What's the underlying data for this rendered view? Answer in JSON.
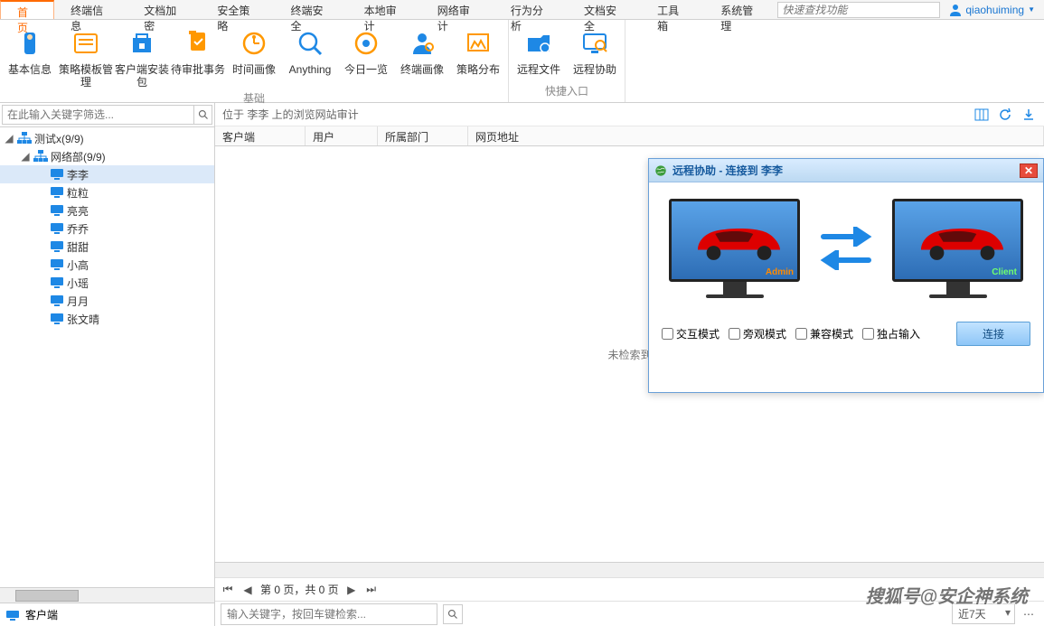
{
  "tabs": [
    "首页",
    "终端信息",
    "文档加密",
    "安全策略",
    "终端安全",
    "本地审计",
    "网络审计",
    "行为分析",
    "文档安全",
    "工具箱",
    "系统管理"
  ],
  "active_tab_index": 0,
  "top_search_placeholder": "快速查找功能",
  "user_name": "qiaohuiming",
  "ribbon_groups": [
    {
      "label": "基础",
      "items": [
        "基本信息",
        "策略模板管理",
        "客户端安装包",
        "待审批事务",
        "时间画像",
        "Anything",
        "今日一览",
        "终端画像",
        "策略分布"
      ]
    },
    {
      "label": "快捷入口",
      "items": [
        "远程文件",
        "远程协助"
      ]
    }
  ],
  "filter_placeholder": "在此输入关键字筛选...",
  "tree": {
    "root": {
      "label": "测试x(9/9)"
    },
    "dept": {
      "label": "网络部(9/9)"
    },
    "members": [
      "李李",
      "粒粒",
      "亮亮",
      "乔乔",
      "甜甜",
      "小高",
      "小瑶",
      "月月",
      "张文晴"
    ],
    "selected_index": 0
  },
  "sidebar_footer": "客户端",
  "breadcrumb": "位于 李李 上的浏览网站审计",
  "columns": {
    "c0": "客户端",
    "c1": "用户",
    "c2": "所属部门",
    "c3": "网页地址"
  },
  "empty_text": "未检索到",
  "pager": "第 0 页，共 0 页",
  "bottom_search_placeholder": "输入关键字，按回车键检索...",
  "date_filter": "近7天",
  "dialog": {
    "title": "远程协助 - 连接到 李李",
    "admin_label": "Admin",
    "client_label": "Client",
    "opts": [
      "交互模式",
      "旁观模式",
      "兼容模式",
      "独占输入"
    ],
    "connect": "连接"
  },
  "watermark": "搜狐号@安企神系统",
  "ribbon_colors": [
    "#1e88e5",
    "#ff9800",
    "#1e88e5",
    "#ff9800",
    "#ff9800",
    "#1e88e5",
    "#ff9800",
    "#1e88e5",
    "#ff9800",
    "#1e88e5",
    "#1e88e5"
  ]
}
